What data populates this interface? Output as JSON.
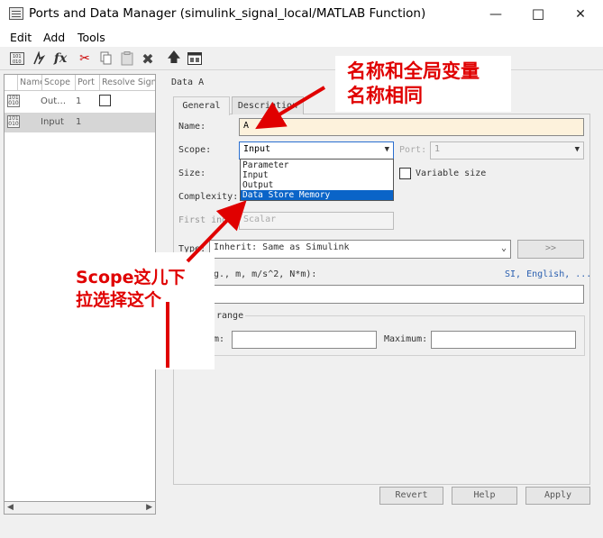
{
  "window": {
    "title": "Ports and Data Manager (simulink_signal_local/MATLAB Function)",
    "minimize": "—",
    "maximize": "☐",
    "close": "✕"
  },
  "menu": {
    "edit": "Edit",
    "add": "Add",
    "tools": "Tools"
  },
  "toolbar": {
    "add_data": "add-data",
    "add_event": "add-event",
    "add_fx": "fx"
  },
  "list": {
    "headers": [
      "Name",
      "Scope",
      "Port",
      "Resolve Sign"
    ],
    "rows": [
      {
        "scope": "Out…",
        "port": "1"
      },
      {
        "scope": "Input",
        "port": "1"
      }
    ]
  },
  "panel": {
    "title": "Data A",
    "tabs": [
      "General",
      "Description"
    ],
    "name_label": "Name:",
    "name_value": "A",
    "scope_label": "Scope:",
    "scope_value": "Input",
    "port_label": "Port:",
    "port_value": "1",
    "size_label": "Size:",
    "variable_size_label": "Variable size",
    "complexity_label": "Complexity:",
    "first_index_label": "First index",
    "first_index_value": "Scalar",
    "type_label": "Type:",
    "type_value": "Inherit: Same as Simulink",
    "type_expand": ">>",
    "unit_label": "g., m, m/s^2, N*m):",
    "unit_links": "SI, English, ...",
    "range_label": "range",
    "min_label": "m:",
    "max_label": "Maximum:",
    "scope_options": [
      "Parameter",
      "Input",
      "Output",
      "Data Store Memory"
    ]
  },
  "buttons": {
    "revert": "Revert",
    "help": "Help",
    "apply": "Apply"
  },
  "annotations": {
    "top": [
      "名称和全局变量",
      "名称相同"
    ],
    "bottom": [
      "Scope这儿下",
      "拉选择这个"
    ]
  },
  "colors": {
    "selection": "#0a64c8",
    "name_field_bg": "#fdf2dc",
    "annotation": "#e00000"
  }
}
